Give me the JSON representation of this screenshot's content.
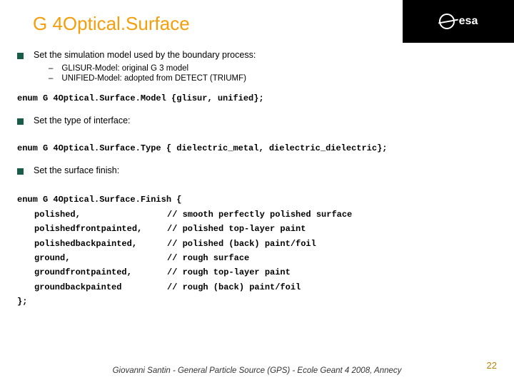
{
  "logo_text": "esa",
  "title": "G 4Optical.Surface",
  "section1": {
    "text": "Set the simulation model used by the boundary process:",
    "sub1": "GLISUR-Model: original G 3 model",
    "sub2": "UNIFIED-Model: adopted from DETECT (TRIUMF)"
  },
  "code1": "enum G 4Optical.Surface.Model {glisur, unified};",
  "section2": {
    "text": "Set the type of interface:"
  },
  "code2": "enum G 4Optical.Surface.Type { dielectric_metal, dielectric_dielectric};",
  "section3": {
    "text": "Set the surface finish:"
  },
  "code3_head": "enum G 4Optical.Surface.Finish {",
  "code3_rows": [
    {
      "k": "polished,",
      "c": "// smooth perfectly polished surface"
    },
    {
      "k": "polishedfrontpainted,",
      "c": "// polished top-layer paint"
    },
    {
      "k": "polishedbackpainted,",
      "c": "// polished (back) paint/foil"
    },
    {
      "k": "ground,",
      "c": "// rough surface"
    },
    {
      "k": "groundfrontpainted,",
      "c": "// rough top-layer paint"
    },
    {
      "k": "groundbackpainted",
      "c": "// rough (back) paint/foil"
    }
  ],
  "code3_tail": "};",
  "footer": "Giovanni Santin  -  General Particle Source (GPS)  -  Ecole Geant 4 2008, Annecy",
  "page": "22"
}
